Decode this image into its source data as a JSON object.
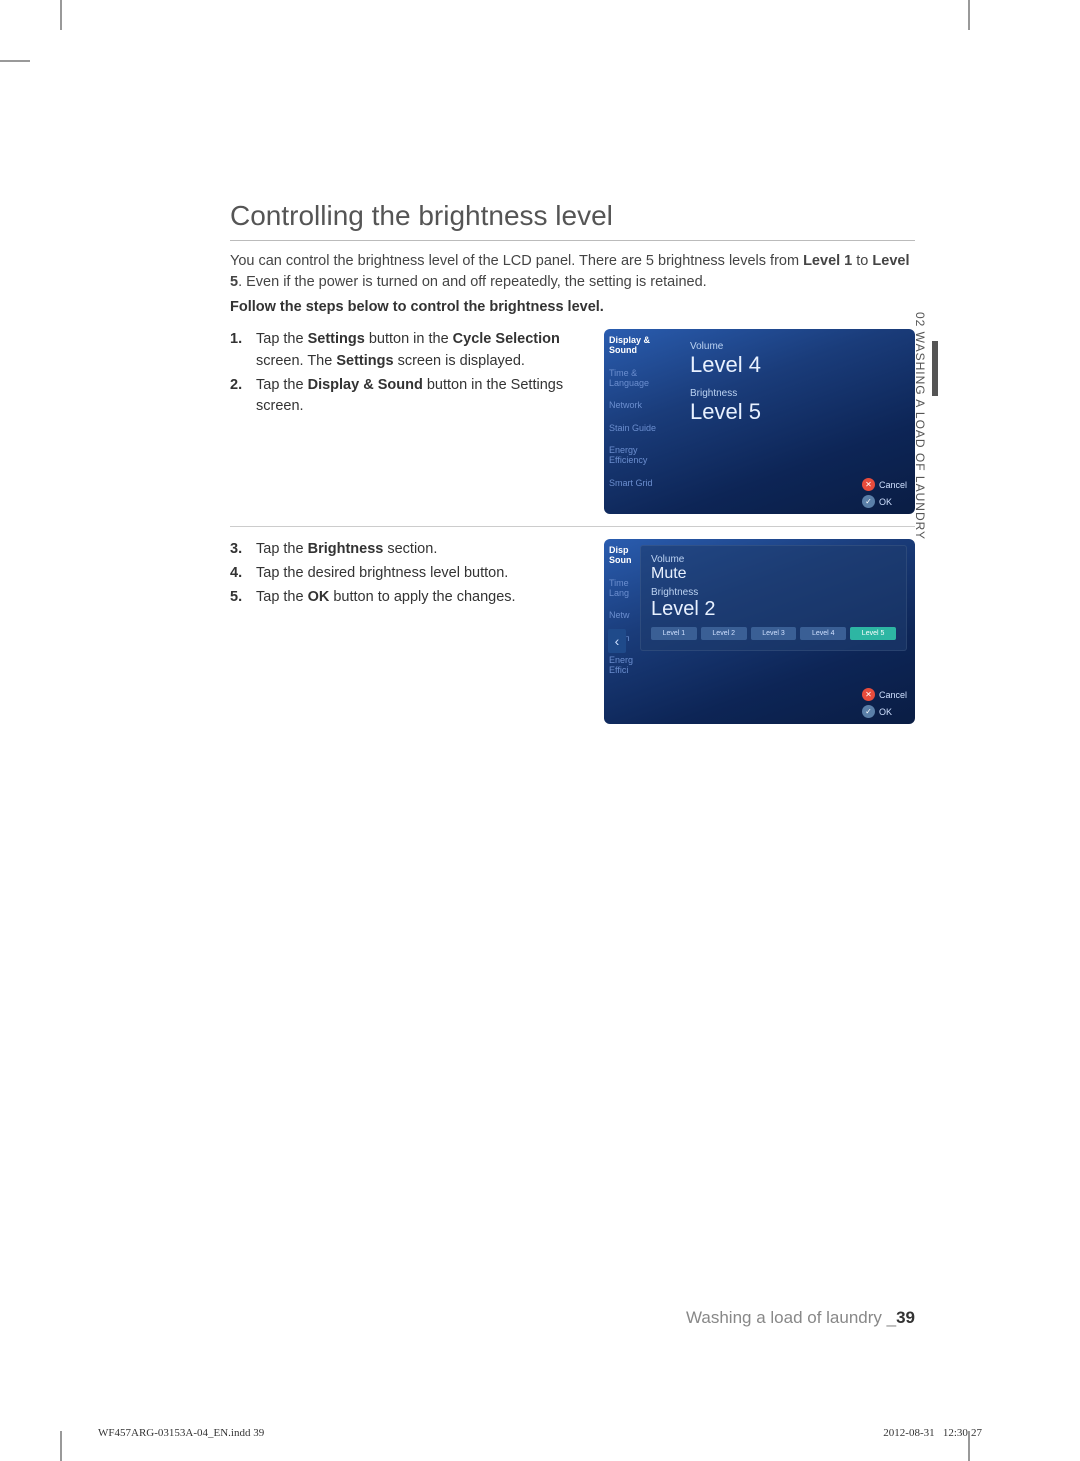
{
  "heading": "Controlling the brightness level",
  "intro_parts": {
    "p1_prefix": "You can control the brightness level of the LCD panel. There are 5 brightness levels from ",
    "level1": "Level 1",
    "mid": " to ",
    "level5": "Level 5",
    "p1_suffix": ". Even if the power is turned on and off repeatedly, the setting is retained."
  },
  "follow": "Follow the steps below to control the brightness level.",
  "steps_a": [
    {
      "num": "1.",
      "prefix": "Tap the ",
      "bold1": "Settings",
      "mid1": " button in the ",
      "bold2": "Cycle Selection",
      "mid2": " screen. The ",
      "bold3": "Settings",
      "suffix": " screen is displayed."
    },
    {
      "num": "2.",
      "prefix": "Tap the ",
      "bold1": "Display & Sound",
      "mid1": " button in the Settings screen.",
      "bold2": "",
      "mid2": "",
      "bold3": "",
      "suffix": ""
    }
  ],
  "steps_b": [
    {
      "num": "3.",
      "prefix": "Tap the ",
      "bold1": "Brightness",
      "suffix": " section."
    },
    {
      "num": "4.",
      "prefix": "Tap the desired brightness level button.",
      "bold1": "",
      "suffix": ""
    },
    {
      "num": "5.",
      "prefix": "Tap the ",
      "bold1": "OK",
      "suffix": " button to apply the changes."
    }
  ],
  "screenshot1": {
    "sidebar": [
      "Display & Sound",
      "Time & Language",
      "Network",
      "Stain Guide",
      "Energy Efficiency",
      "Smart Grid"
    ],
    "volume_label": "Volume",
    "volume_value": "Level 4",
    "brightness_label": "Brightness",
    "brightness_value": "Level 5",
    "cancel": "Cancel",
    "ok": "OK"
  },
  "screenshot2": {
    "sidebar": [
      "Disp Soun",
      "Time Lang",
      "Netw",
      "Stain",
      "Energ Effici"
    ],
    "volume_label": "Volume",
    "volume_value": "Mute",
    "brightness_label": "Brightness",
    "brightness_value": "Level 2",
    "levels": [
      "Level 1",
      "Level 2",
      "Level 3",
      "Level 4",
      "Level 5"
    ],
    "back": "‹",
    "cancel": "Cancel",
    "ok": "OK"
  },
  "side_tab": "02 WASHING A LOAD OF LAUNDRY",
  "footer": {
    "text": "Washing a load of laundry _",
    "page": "39"
  },
  "slug": "WF457ARG-03153A-04_EN.indd   39",
  "date": "2012-08-31",
  "time": "12:30:27"
}
